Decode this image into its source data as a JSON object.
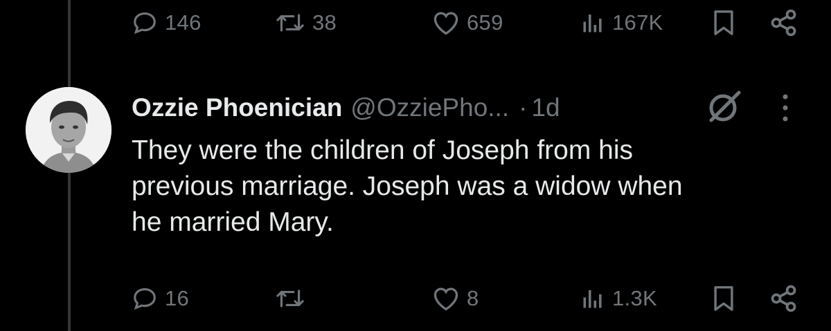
{
  "previous_tweet": {
    "actions": {
      "replies": "146",
      "reposts": "38",
      "likes": "659",
      "views": "167K"
    }
  },
  "reply": {
    "author": {
      "display_name": "Ozzie Phoenician",
      "handle": "@OzziePho...",
      "separator": "·",
      "time": "1d"
    },
    "text_lines": [
      "They were the children of Joseph from his",
      "previous marriage. Joseph was a widow when",
      "he married Mary."
    ],
    "actions": {
      "replies": "16",
      "reposts": "",
      "likes": "8",
      "views": "1.3K"
    }
  },
  "colors": {
    "background": "#000000",
    "text_primary": "#e7e9ea",
    "text_secondary": "#71767b",
    "thread_line": "#333639"
  },
  "icons": [
    "reply-icon",
    "repost-icon",
    "like-icon",
    "views-icon",
    "bookmark-icon",
    "share-icon",
    "grok-icon",
    "more-icon"
  ]
}
